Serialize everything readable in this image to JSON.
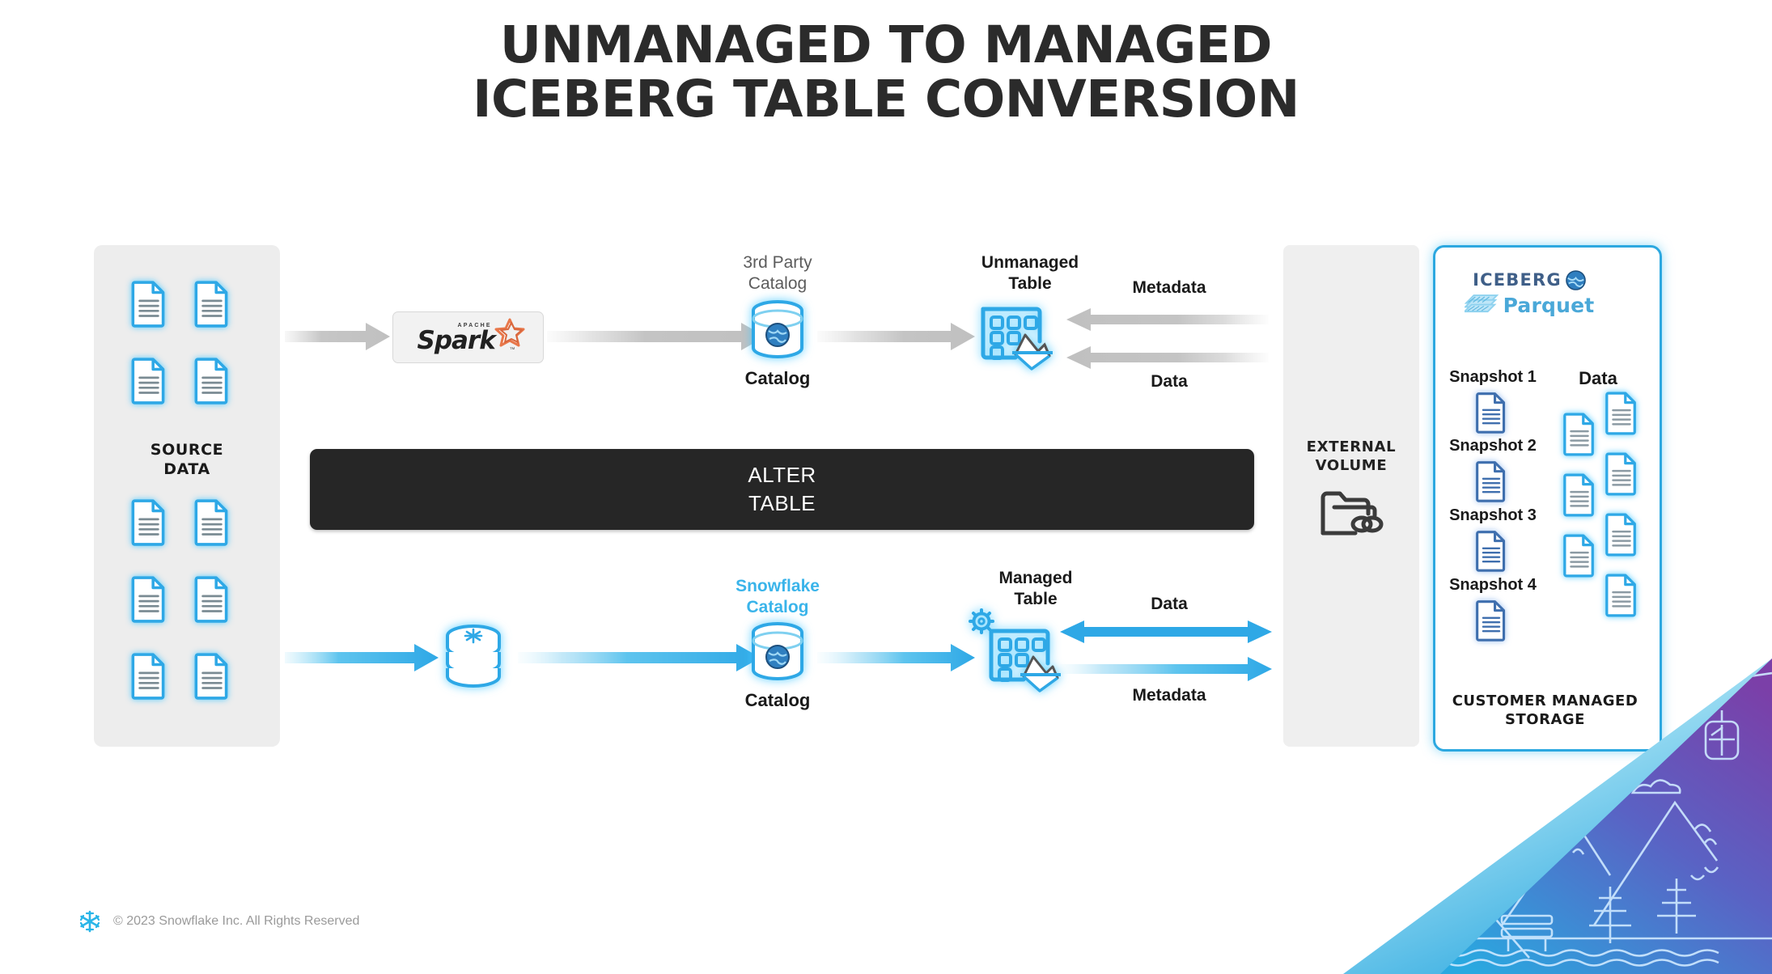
{
  "title": {
    "line1": "UNMANAGED TO MANAGED",
    "line2": "ICEBERG TABLE CONVERSION"
  },
  "source_panel": {
    "label_line1": "SOURCE",
    "label_line2": "DATA",
    "doc_icon_name": "document-icon",
    "doc_count": 10
  },
  "unmanaged_flow": {
    "engine": {
      "name": "apache-spark-logo",
      "apache_text": "APACHE",
      "spark_text": "Spark",
      "tm_text": "TM"
    },
    "catalog": {
      "top_label_line1": "3rd Party",
      "top_label_line2": "Catalog",
      "bottom_label": "Catalog"
    },
    "table": {
      "top_label_line1": "Unmanaged",
      "top_label_line2": "Table"
    },
    "arrow_top_label": "Metadata",
    "arrow_bottom_label": "Data"
  },
  "managed_flow": {
    "engine": {
      "name": "snowflake-database-icon"
    },
    "catalog": {
      "top_label_line1": "Snowflake",
      "top_label_line2": "Catalog",
      "bottom_label": "Catalog"
    },
    "table": {
      "top_label_line1": "Managed",
      "top_label_line2": "Table"
    },
    "arrow_top_label": "Data",
    "arrow_bottom_label": "Metadata"
  },
  "alter_banner": {
    "line1": "ALTER",
    "line2": "TABLE"
  },
  "external_volume": {
    "label_line1": "EXTERNAL",
    "label_line2": "VOLUME",
    "icon_name": "folder-link-icon"
  },
  "customer_storage": {
    "iceberg_word": "ICEBERG",
    "parquet_word": "Parquet",
    "snapshot_column_items": [
      "Snapshot 1",
      "Snapshot 2",
      "Snapshot 3",
      "Snapshot 4"
    ],
    "data_column_header": "Data",
    "data_doc_count": 7,
    "label_line1": "CUSTOMER MANAGED",
    "label_line2": "STORAGE"
  },
  "footer": {
    "logo_name": "snowflake-logo",
    "copyright": "© 2023 Snowflake Inc. All Rights Reserved"
  },
  "colors": {
    "accent_blue": "#29b5e8",
    "dark_blue": "#3f5f88",
    "banner_dark": "#262626",
    "panel_gray": "#ededed",
    "arrow_gray": "#c4c4c4",
    "spark_orange": "#e8774a",
    "purple": "#6b3fa0"
  }
}
